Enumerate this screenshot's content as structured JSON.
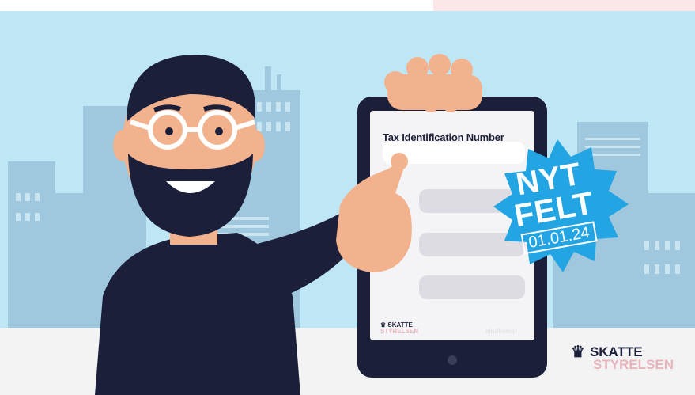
{
  "tablet": {
    "title": "Tax Identification Number",
    "logo_line1": "SKATTE",
    "logo_line2": "STYRELSEN",
    "footer": "eIndkomst"
  },
  "badge": {
    "line1": "NYT",
    "line2": "FELT",
    "date": "01.01.24"
  },
  "brand": {
    "line1": "SKATTE",
    "line2": "STYRELSEN"
  },
  "colors": {
    "sky": "#bfe6f5",
    "buildings": "#9fc8de",
    "badge": "#22a5e2",
    "dark": "#1b1f3a",
    "pink": "#e8b4bc",
    "skin": "#f2b28e"
  },
  "icons": [
    "crown-icon"
  ]
}
